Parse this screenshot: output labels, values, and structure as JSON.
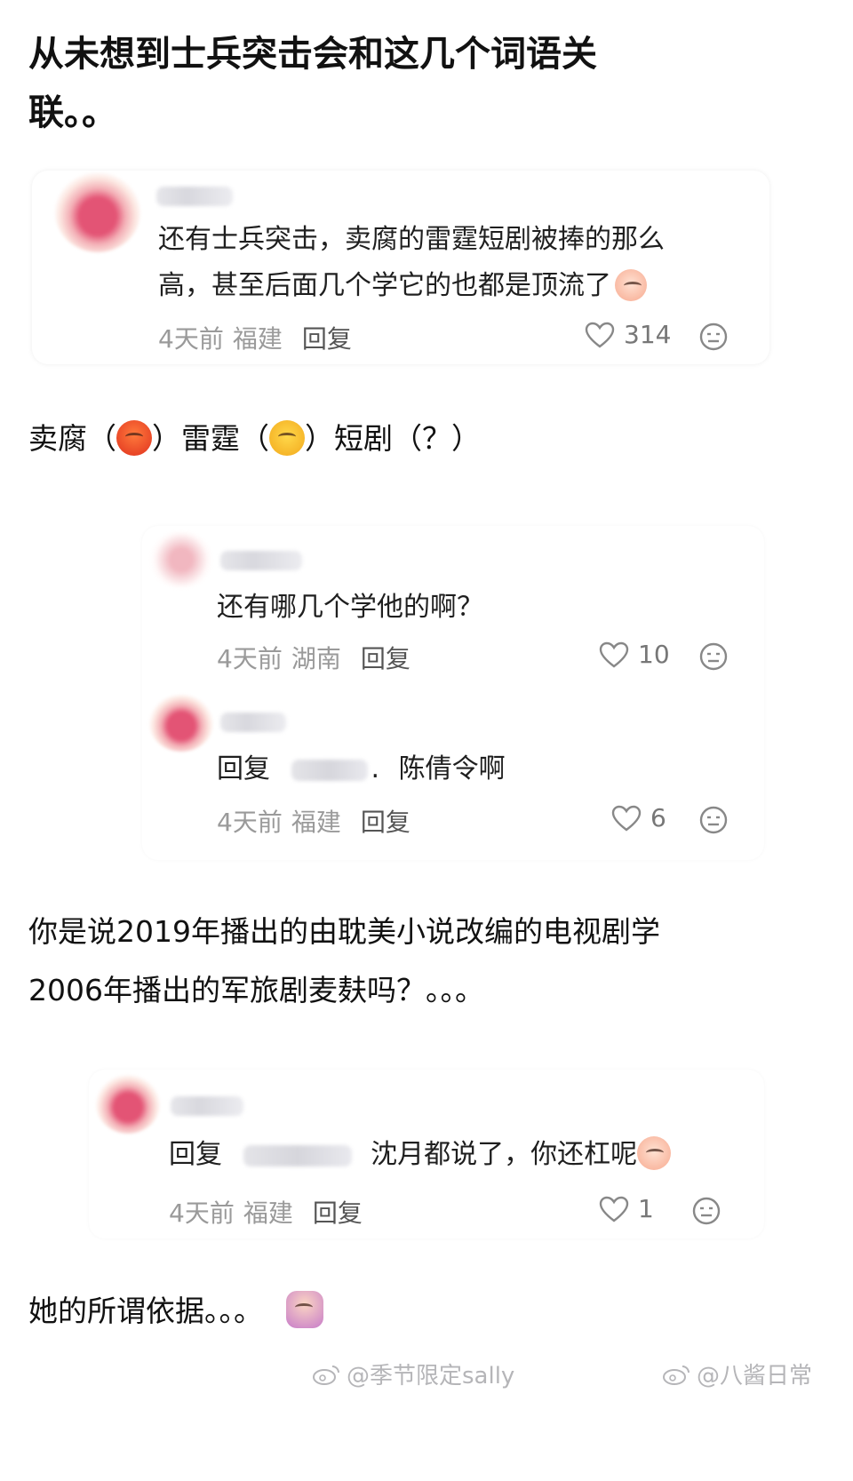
{
  "headline": {
    "line1": "从未想到士兵突击会和这几个词语关",
    "line2": "联。。"
  },
  "comment_main": {
    "text_line1": "还有士兵突击，卖腐的雷霆短剧被捧的那么",
    "text_line2": "高，甚至后面几个学它的也都是顶流了",
    "time": "4天前",
    "location": "福建",
    "reply_label": "回复",
    "likes": "314"
  },
  "narr1": {
    "w1": "卖腐（",
    "w2": "）雷霆（",
    "w3": "）短剧（？）"
  },
  "reply1": {
    "text": "还有哪几个学他的啊？",
    "time": "4天前",
    "location": "湖南",
    "reply_label": "回复",
    "likes": "10"
  },
  "reply2": {
    "prefix": "回复",
    "sep": ".",
    "text": "陈倩令啊",
    "time": "4天前",
    "location": "福建",
    "reply_label": "回复",
    "likes": "6"
  },
  "narr2": {
    "line1": "你是说2019年播出的由耽美小说改编的电视剧学",
    "line2": "2006年播出的军旅剧麦麸吗？。。。"
  },
  "reply3": {
    "prefix": "回复",
    "text": "沈月都说了，你还杠呢",
    "time": "4天前",
    "location": "福建",
    "reply_label": "回复",
    "likes": "1"
  },
  "narr3": {
    "text": "她的所谓依据。。。"
  },
  "watermarks": {
    "left": "@季节限定sally",
    "right": "@八酱日常"
  },
  "icons": {
    "like": "heart-outline-icon",
    "dislike": "unamused-face-icon",
    "weibo": "weibo-logo-icon"
  }
}
